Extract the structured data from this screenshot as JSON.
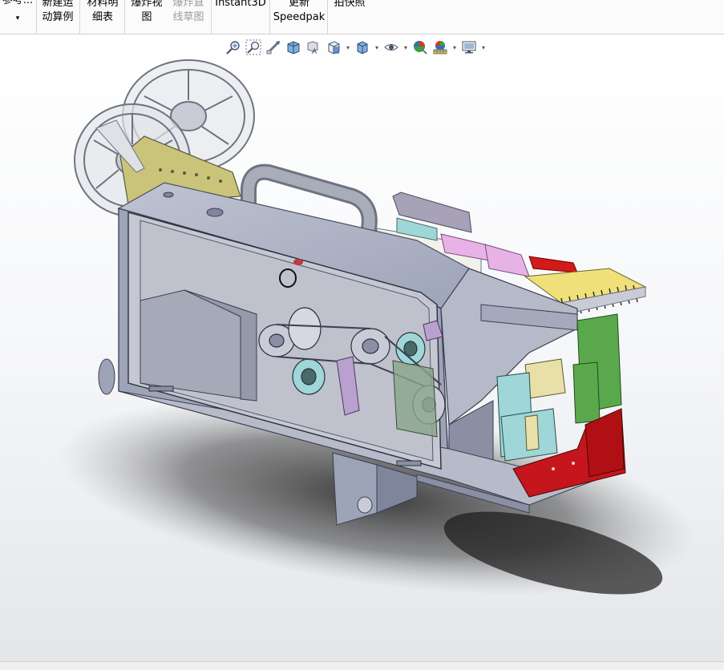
{
  "ribbon": {
    "ref_label": "参考...",
    "ref_arrow": "▾",
    "motion_line1": "新建运",
    "motion_line2": "动算例",
    "bom_line1": "材料明",
    "bom_line2": "细表",
    "explode_line1": "爆炸视",
    "explode_line2": "图",
    "explode_sketch_line1": "爆炸直",
    "explode_sketch_line2": "线草图",
    "instant3d": "Instant3D",
    "speedpak_line1": "更新",
    "speedpak_line2": "Speedpak",
    "snapshot": "拍快照"
  },
  "view_toolbar": {
    "icons": [
      "zoom-to-fit-icon",
      "zoom-to-area-icon",
      "previous-view-icon",
      "section-view-icon",
      "dynamic-annotation-icon",
      "view-orientation-icon",
      "display-style-icon",
      "hide-show-items-icon",
      "edit-appearance-icon",
      "apply-scene-icon",
      "view-settings-icon"
    ],
    "colors": {
      "blue": "#2f6fb6",
      "gray": "#6e7380",
      "red": "#d23a2a",
      "green": "#3aa13a",
      "yellow": "#e0c23a"
    }
  },
  "model": {
    "colors": {
      "body_gray": "#9ea4b8",
      "body_dark": "#7f859b",
      "window_glass": "#c9ccd6",
      "red_block": "#c4161c",
      "green_block": "#5aa84c",
      "olive_plate": "#c9c47a",
      "cyan_part": "#9fd6d8",
      "pink_part": "#e7b3e6",
      "purple_part": "#b9a0cf",
      "handle_gray": "#8e92a0"
    }
  }
}
